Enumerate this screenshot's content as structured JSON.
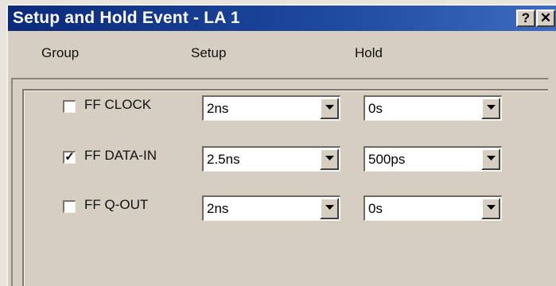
{
  "window": {
    "title": "Setup and Hold Event - LA 1",
    "help_label": "?",
    "close_label": "✕"
  },
  "columns": {
    "group": "Group",
    "setup": "Setup",
    "hold": "Hold"
  },
  "rows": [
    {
      "label": "FF CLOCK",
      "checked": false,
      "check_mark": "",
      "setup": "2ns",
      "hold": "0s"
    },
    {
      "label": "FF DATA-IN",
      "checked": true,
      "check_mark": "✓",
      "setup": "2.5ns",
      "hold": "500ps"
    },
    {
      "label": "FF Q-OUT",
      "checked": false,
      "check_mark": "",
      "setup": "2ns",
      "hold": "0s"
    }
  ],
  "icons": {
    "help": "help-icon",
    "close": "close-icon",
    "dropdown": "chevron-down-icon",
    "checkbox": "checkbox-icon"
  },
  "colors": {
    "titlebar_start": "#0b2a7a",
    "titlebar_end": "#3d6cc0",
    "dialog_face": "#d5cec1"
  }
}
